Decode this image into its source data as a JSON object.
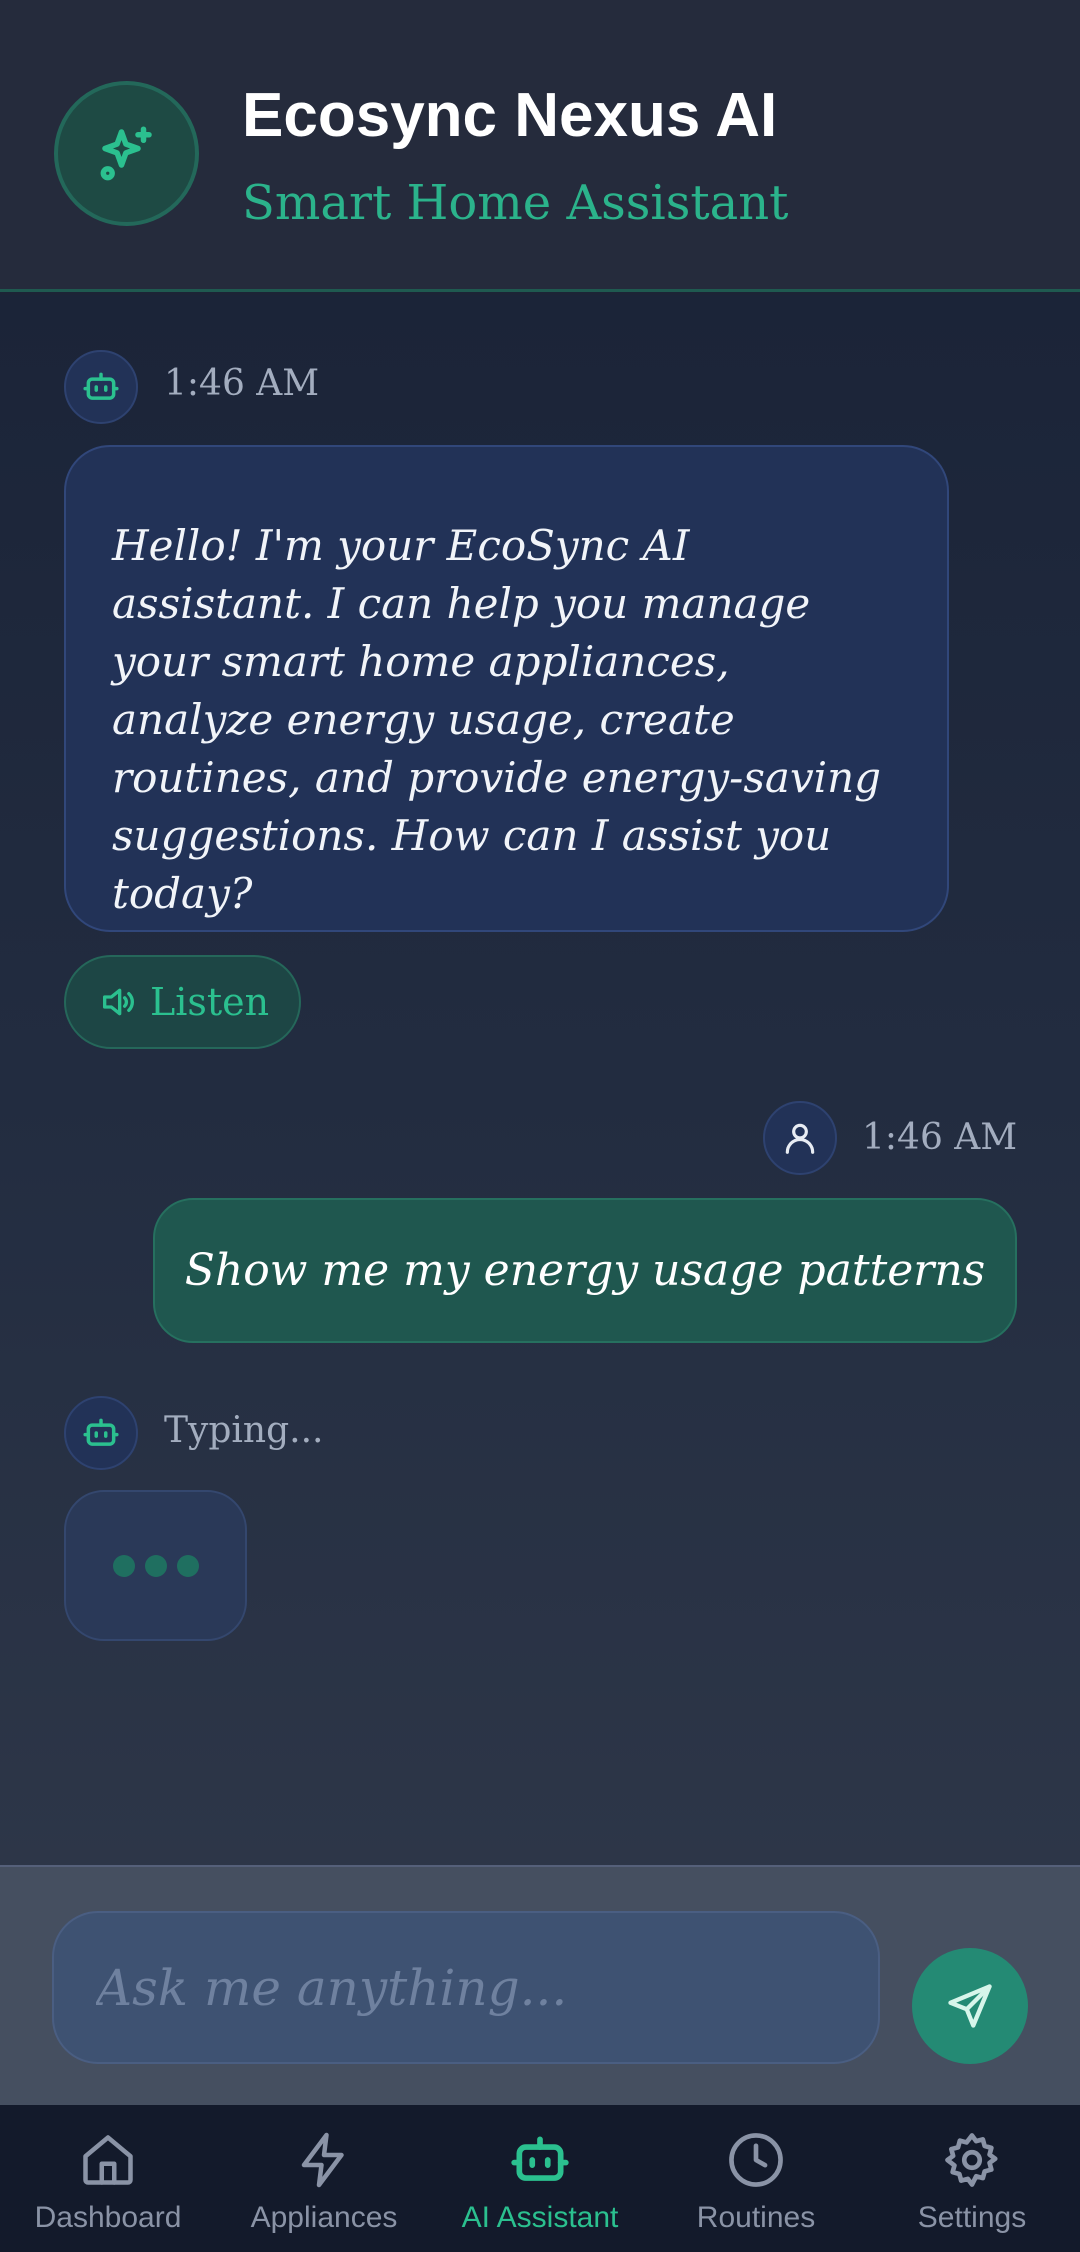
{
  "header": {
    "title": "Ecosync Nexus AI",
    "subtitle": "Smart Home Assistant",
    "logo_icon": "sparkles-icon"
  },
  "messages": [
    {
      "sender": "bot",
      "time": "1:46 AM",
      "avatar_icon": "bot-icon",
      "text": "Hello! I'm your EcoSync AI assistant. I can help you manage your smart home appliances, analyze energy usage, create routines, and provide energy-saving suggestions. How can I assist you today?",
      "listen_label": "Listen",
      "listen_icon": "speaker-icon"
    },
    {
      "sender": "user",
      "time": "1:46 AM",
      "avatar_icon": "user-icon",
      "text": "Show me my energy usage patterns"
    }
  ],
  "typing": {
    "status": "Typing...",
    "avatar_icon": "bot-icon"
  },
  "composer": {
    "placeholder": "Ask me anything...",
    "send_icon": "send-icon"
  },
  "nav": {
    "items": [
      {
        "label": "Dashboard",
        "icon": "home-icon",
        "active": false
      },
      {
        "label": "Appliances",
        "icon": "lightning-icon",
        "active": false
      },
      {
        "label": "AI Assistant",
        "icon": "bot-icon",
        "active": true
      },
      {
        "label": "Routines",
        "icon": "clock-icon",
        "active": false
      },
      {
        "label": "Settings",
        "icon": "gear-icon",
        "active": false
      }
    ]
  },
  "colors": {
    "accent": "#2bc08f",
    "header_bg": "#252b3c",
    "bot_bubble": "#223257",
    "user_bubble": "#1f574f",
    "nav_bg": "#131a2b"
  }
}
